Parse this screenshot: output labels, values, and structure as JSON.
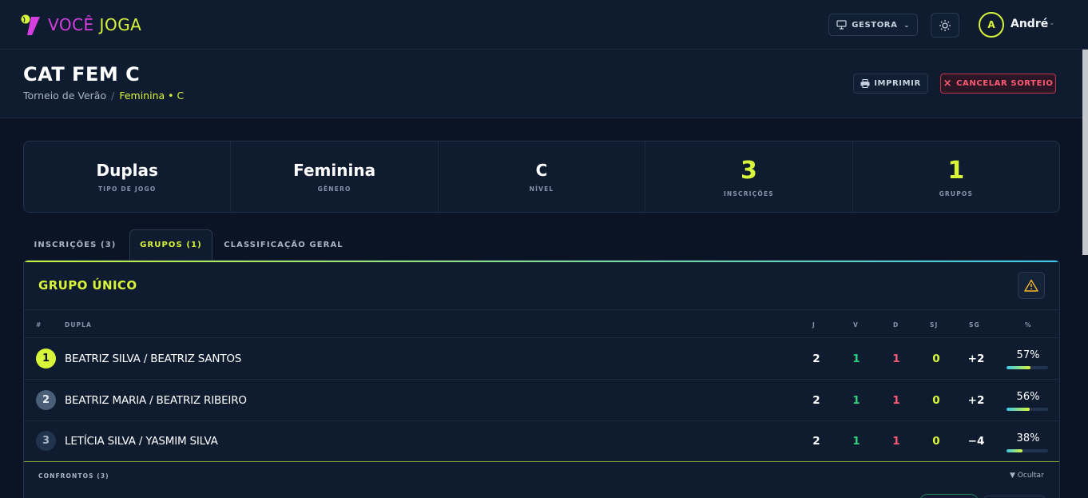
{
  "brand": {
    "voce": "VOCÊ",
    "joga": "JOGA",
    "colors": {
      "pink": "#d63ee0",
      "lime": "#d8f53a"
    }
  },
  "topbar": {
    "role_label": "GESTORA",
    "role_icon": "monitor-icon",
    "theme_icon": "sun-icon",
    "avatar_initial": "A",
    "user_name": "André"
  },
  "header": {
    "title": "CAT FEM C",
    "breadcrumb": {
      "parent": "Torneio de Verão",
      "separator": "/",
      "current": "Feminina • C"
    },
    "print_label": "IMPRIMIR",
    "cancel_label": "CANCELAR SORTEIO"
  },
  "stats": [
    {
      "value": "Duplas",
      "label": "TIPO DE JOGO"
    },
    {
      "value": "Feminina",
      "label": "GÊNERO"
    },
    {
      "value": "C",
      "label": "NÍVEL"
    },
    {
      "value": "3",
      "label": "INSCRIÇÕES"
    },
    {
      "value": "1",
      "label": "GRUPOS"
    }
  ],
  "tabs": [
    {
      "label": "INSCRIÇÕES (3)",
      "active": false
    },
    {
      "label": "GRUPOS (1)",
      "active": true
    },
    {
      "label": "CLASSIFICAÇÃO GERAL",
      "active": false
    }
  ],
  "group": {
    "title": "GRUPO ÚNICO",
    "columns": {
      "rank": "#",
      "dupla": "DUPLA",
      "j": "J",
      "v": "V",
      "d": "D",
      "sj": "SJ",
      "sg": "SG",
      "pct": "%"
    },
    "rows": [
      {
        "rank": "1",
        "dupla": "BEATRIZ SILVA / BEATRIZ SANTOS",
        "j": "2",
        "v": "1",
        "d": "1",
        "sj": "0",
        "sg": "+2",
        "pct": "57%",
        "pct_value": 57
      },
      {
        "rank": "2",
        "dupla": "BEATRIZ MARIA / BEATRIZ RIBEIRO",
        "j": "2",
        "v": "1",
        "d": "1",
        "sj": "0",
        "sg": "+2",
        "pct": "56%",
        "pct_value": 56
      },
      {
        "rank": "3",
        "dupla": "LETÍCIA SILVA / YASMIM SILVA",
        "j": "2",
        "v": "1",
        "d": "1",
        "sj": "0",
        "sg": "−4",
        "pct": "38%",
        "pct_value": 38
      }
    ],
    "confrontos_label": "CONFRONTOS (3)",
    "hide_label": "▼ Ocultar"
  }
}
